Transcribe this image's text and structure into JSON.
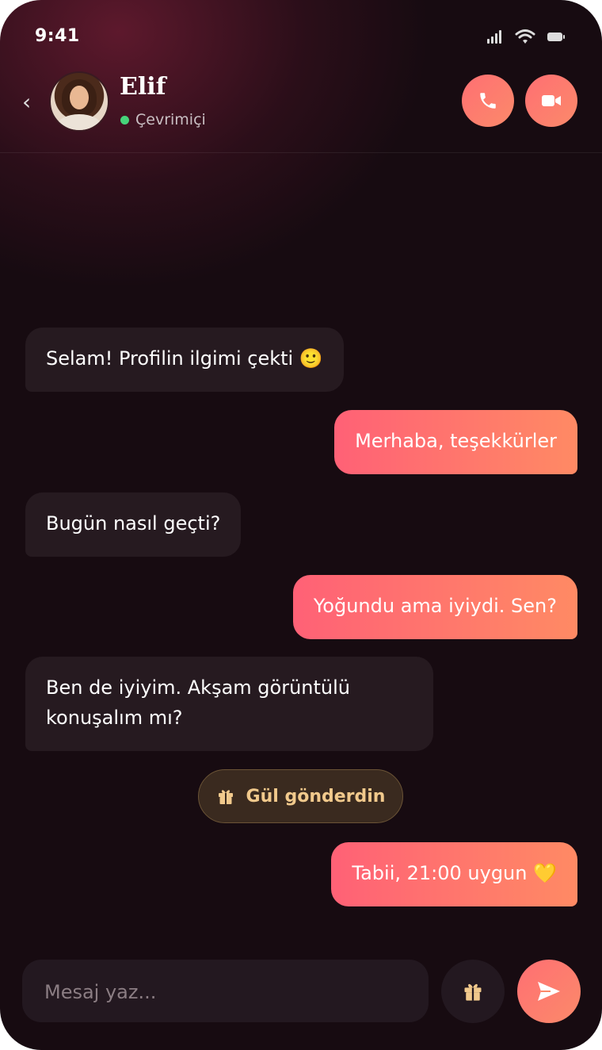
{
  "status_bar": {
    "time": "9:41",
    "icons": [
      "signal-icon",
      "wifi-icon",
      "battery-icon"
    ]
  },
  "header": {
    "back_icon": "chevron-left-icon",
    "name": "Elif",
    "presence": "Çevrimiçi",
    "presence_color": "#46d37a",
    "actions": [
      "phone-icon",
      "video-icon"
    ]
  },
  "messages": [
    {
      "side": "incoming",
      "text": "Selam! Profilin ilgimi çekti 🙂"
    },
    {
      "side": "outgoing",
      "text": "Merhaba, teşekkürler"
    },
    {
      "side": "incoming",
      "text": "Bugün nasıl geçti?"
    },
    {
      "side": "outgoing",
      "text": "Yoğundu ama iyiydi. Sen?"
    },
    {
      "side": "incoming",
      "text": "Ben de iyiyim. Akşam görüntülü konuşalım mı?"
    },
    {
      "side": "outgoing",
      "text": "Tabii, 21:00 uygun 💛"
    }
  ],
  "gift_notice": {
    "icon": "gift-icon",
    "text": "Gül gönderdin"
  },
  "composer": {
    "placeholder": "Mesaj yaz...",
    "value": "",
    "gift_icon": "gift-icon",
    "send_icon": "send-icon"
  },
  "colors": {
    "background": "#170b11",
    "accent_start": "#ff6176",
    "accent_end": "#ff8a64",
    "incoming_bubble": "#261a20",
    "gift_text": "#f1c98c"
  }
}
